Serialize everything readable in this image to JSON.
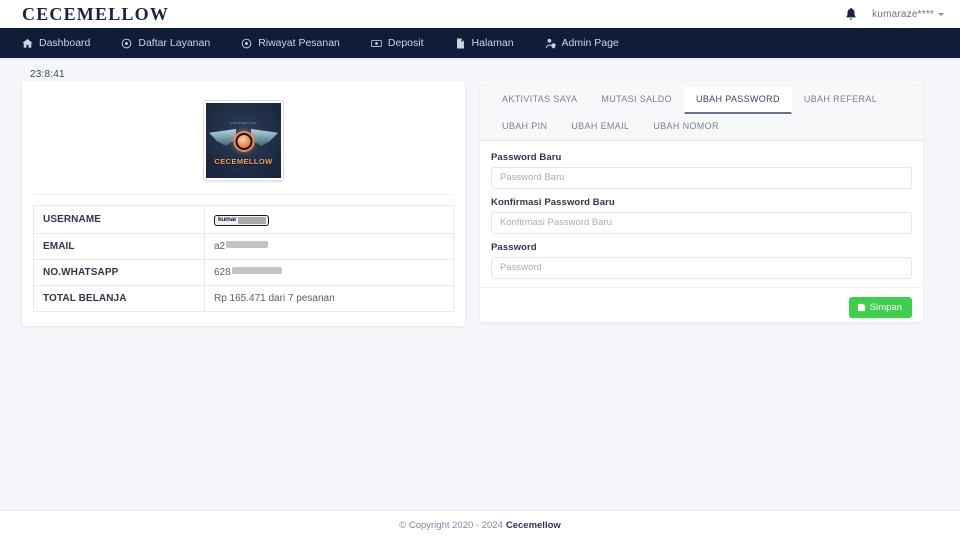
{
  "header": {
    "brand": "CECEMELLOW",
    "bell_icon": "bell-icon",
    "username": "kumaraze****",
    "caret_icon": "chevron-down-icon"
  },
  "nav": {
    "items": [
      {
        "label": "Dashboard",
        "icon": "home-icon"
      },
      {
        "label": "Daftar Layanan",
        "icon": "circle-dot-icon"
      },
      {
        "label": "Riwayat Pesanan",
        "icon": "circle-dot-icon"
      },
      {
        "label": "Deposit",
        "icon": "money-bill-icon"
      },
      {
        "label": "Halaman",
        "icon": "file-icon"
      },
      {
        "label": "Admin Page",
        "icon": "user-shield-icon"
      }
    ]
  },
  "clock": "23:8:41",
  "profile": {
    "logo_alt": "CECEMELLOW",
    "logo_text": "CECEMELLOW",
    "logo_top_text": "CECEMELLOW",
    "rows": [
      {
        "key": "USERNAME",
        "value_visible": "kumar",
        "redacted": true,
        "type": "badge"
      },
      {
        "key": "EMAIL",
        "value_visible": "a2",
        "redacted": true,
        "type": "line1"
      },
      {
        "key": "NO.WHATSAPP",
        "value_visible": "628",
        "redacted": true,
        "type": "line2"
      },
      {
        "key": "TOTAL BELANJA",
        "value_visible": "Rp 165.471 dari 7 pesanan",
        "redacted": false,
        "type": "text"
      }
    ]
  },
  "panel": {
    "tabs": [
      {
        "label": "AKTIVITAS SAYA",
        "active": false
      },
      {
        "label": "MUTASI SALDO",
        "active": false
      },
      {
        "label": "UBAH PASSWORD",
        "active": true
      },
      {
        "label": "UBAH REFERAL",
        "active": false
      },
      {
        "label": "UBAH PIN",
        "active": false
      },
      {
        "label": "UBAH EMAIL",
        "active": false
      },
      {
        "label": "UBAH NOMOR",
        "active": false
      }
    ],
    "fields": [
      {
        "label": "Password Baru",
        "placeholder": "Password Baru",
        "value": ""
      },
      {
        "label": "Konfirmasi Password Baru",
        "placeholder": "Konfirmasi Password Baru",
        "value": ""
      },
      {
        "label": "Password",
        "placeholder": "Password",
        "value": ""
      }
    ],
    "save_label": "Simpan",
    "save_icon": "save-icon"
  },
  "footer": {
    "copyright": "© Copyright 2020 - 2024",
    "brand": "Cecemellow"
  },
  "colors": {
    "navbar": "#111c38",
    "page_bg": "#f4f6f9",
    "save_green": "#3fce4e",
    "tab_head": "#f7f8fa",
    "text": "#3d4465"
  }
}
